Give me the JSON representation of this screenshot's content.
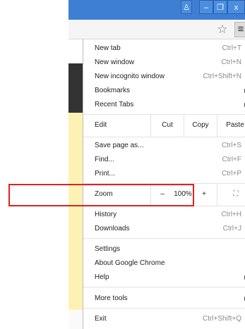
{
  "window": {
    "min_label": "‒",
    "restore_label": "❐",
    "close_label": "x"
  },
  "menu": {
    "group1": [
      {
        "label": "New tab",
        "shortcut": "Ctrl+T"
      },
      {
        "label": "New window",
        "shortcut": "Ctrl+N"
      },
      {
        "label": "New incognito window",
        "shortcut": "Ctrl+Shift+N"
      },
      {
        "label": "Bookmarks",
        "shortcut": ""
      },
      {
        "label": "Recent Tabs",
        "shortcut": ""
      }
    ],
    "edit": {
      "label": "Edit",
      "cut": "Cut",
      "copy": "Copy",
      "paste": "Paste"
    },
    "group2": [
      {
        "label": "Save page as...",
        "shortcut": "Ctrl+S"
      },
      {
        "label": "Find...",
        "shortcut": "Ctrl+F"
      },
      {
        "label": "Print...",
        "shortcut": "Ctrl+P"
      }
    ],
    "zoom": {
      "label": "Zoom",
      "minus": "–",
      "value": "100%",
      "plus": "+"
    },
    "group3": [
      {
        "label": "History",
        "shortcut": "Ctrl+H"
      },
      {
        "label": "Downloads",
        "shortcut": "Ctrl+J"
      }
    ],
    "group4": [
      {
        "label": "Settings"
      },
      {
        "label": "About Google Chrome"
      },
      {
        "label": "Help"
      }
    ],
    "more_tools": "More tools",
    "exit": {
      "label": "Exit",
      "shortcut": "Ctrl+Shift+Q"
    }
  },
  "colors": {
    "titlebar": "#3e7fd4",
    "highlight": "#e02020"
  }
}
